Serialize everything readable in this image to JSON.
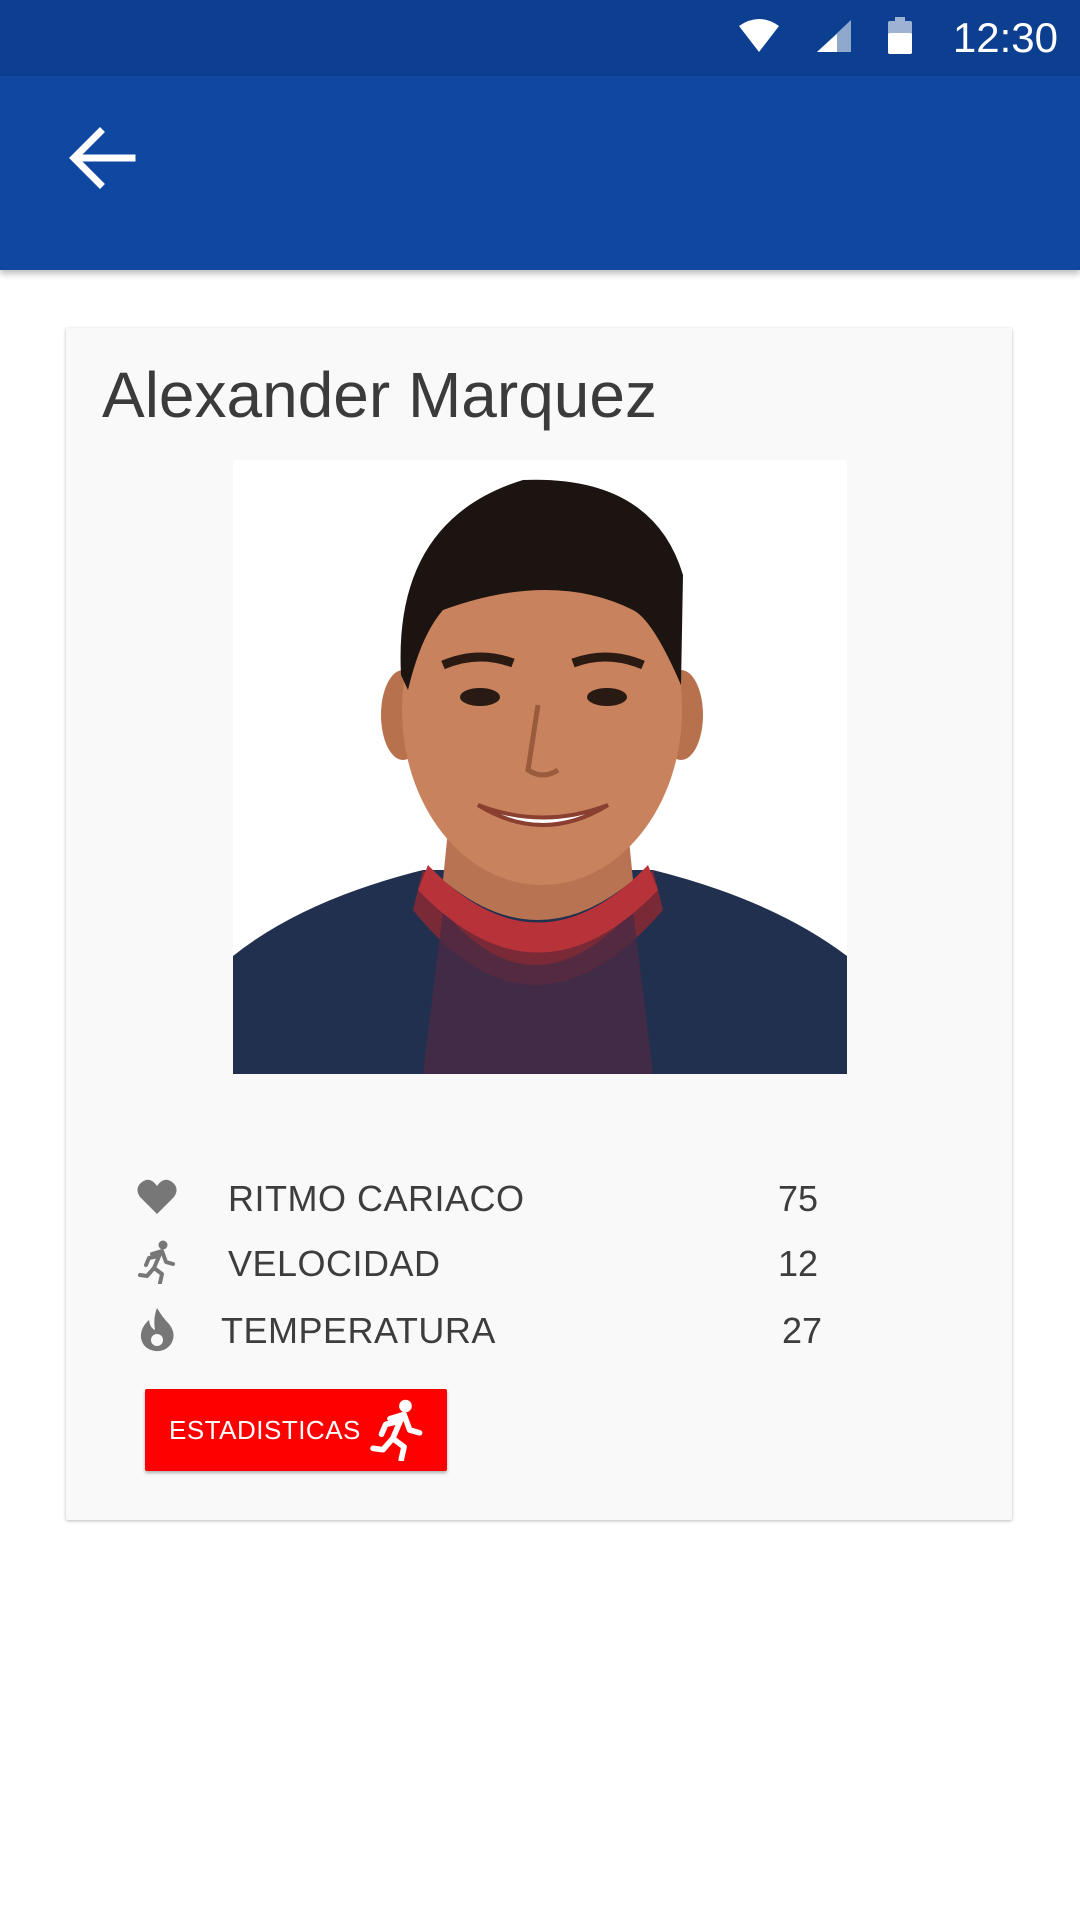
{
  "status_bar": {
    "time": "12:30",
    "icons": [
      "wifi-icon",
      "signal-icon",
      "battery-icon"
    ]
  },
  "app_bar": {
    "back_icon": "arrow-back-icon",
    "color": "#0f47a1"
  },
  "player": {
    "name": "Alexander Marquez",
    "photo": "player-photo"
  },
  "stats": [
    {
      "icon": "heart-icon",
      "label": "RITMO CARIACO",
      "value": "75"
    },
    {
      "icon": "run-icon",
      "label": "VELOCIDAD",
      "value": "12"
    },
    {
      "icon": "fire-icon",
      "label": "TEMPERATURA",
      "value": "27"
    }
  ],
  "stats_button": {
    "label": "ESTADISTICAS",
    "icon": "run-icon",
    "color": "#ff0000"
  },
  "colors": {
    "status_bar": "#0d3f91",
    "app_bar": "#0f47a1",
    "card": "#f9f9f9",
    "text": "#3d3d3d",
    "icon": "#777777"
  }
}
